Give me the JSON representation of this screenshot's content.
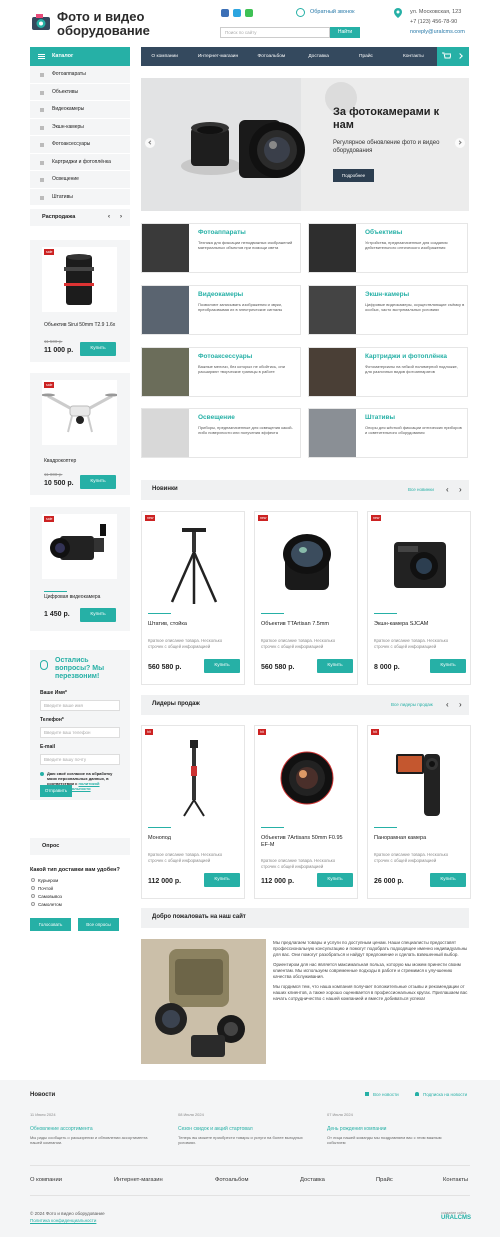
{
  "header": {
    "logo_line1": "Фото и видео",
    "logo_line2": "оборудование",
    "search_placeholder": "Поиск по сайту",
    "search_button": "Найти",
    "callback": "Обратный звонок",
    "address": "ул. Московская, 123",
    "phone": "+7 (123) 456-78-90",
    "email": "noreply@uralcms.com"
  },
  "nav": {
    "catalog": "Каталог",
    "items": [
      "О компании",
      "Интернет-магазин",
      "Фотоальбом",
      "Доставка",
      "Прайс",
      "Контакты"
    ]
  },
  "catalog": [
    "Фотоаппараты",
    "Объективы",
    "Видеокамеры",
    "Экшн-камеры",
    "Фотоаксессуары",
    "Картриджи и фотоплёнка",
    "Освещение",
    "Штативы"
  ],
  "sale": {
    "title": "Распродажа",
    "items": [
      {
        "name": "Объектив Sirui 50mm T2.9 1.6x",
        "old": "11 500 р.",
        "price": "11 000 р.",
        "badge": "sale"
      },
      {
        "name": "Квадрокоптер",
        "old": "11 000 р.",
        "price": "10 500 р.",
        "badge": "sale"
      },
      {
        "name": "Цифровая видеокамера",
        "old": "",
        "price": "1 450 р.",
        "badge": "sale"
      }
    ],
    "buy": "Купить"
  },
  "callback_form": {
    "title": "Остались вопросы? Мы перезвоним!",
    "name_label": "Ваше Имя*",
    "name_ph": "Введите ваше имя",
    "phone_label": "Телефон*",
    "phone_ph": "Введите ваш телефон",
    "email_label": "E-mail",
    "email_ph": "Введите вашу почту",
    "consent": "Даю своё согласие на обработку моих персональных данных, в соответствии с ",
    "consent_link": "политикой конфиденциальности",
    "submit": "Отправить"
  },
  "poll": {
    "title": "Опрос",
    "question": "Какой тип доставки вам удобен?",
    "options": [
      "Курьером",
      "Почтой",
      "Самовывоз",
      "Самолетом"
    ],
    "vote": "Голосовать",
    "all": "Все опросы"
  },
  "hero": {
    "title": "За фотокамерами к нам",
    "subtitle": "Регулярное обновление фото и видео оборудования",
    "button": "Подробнее"
  },
  "categories": [
    {
      "title": "Фотоаппараты",
      "desc": "Техника для фиксации неподвижных изображений материальных объектов при помощи света"
    },
    {
      "title": "Объективы",
      "desc": "Устройства, предназначенные для создания действительного оптического изображения"
    },
    {
      "title": "Видеокамеры",
      "desc": "Позволяют записывать изображения и звуки, преобразовывая их в электрические сигналы"
    },
    {
      "title": "Экшн-камеры",
      "desc": "Цифровые видеокамеры, осуществляющие съёмку в особых, часто экстремальных условиях"
    },
    {
      "title": "Фотоаксессуары",
      "desc": "Важные мелочи, без которых не обойтись, они расширяют творческие границы в работе"
    },
    {
      "title": "Картриджи и фотоплёнка",
      "desc": "Фотоматериалы на гибкой полимерной подложке, для различных видов фотоаппаратов"
    },
    {
      "title": "Освещение",
      "desc": "Приборы, предназначенные для освещения какой-либо поверхности или получения эффекта"
    },
    {
      "title": "Штативы",
      "desc": "Опоры для жёсткой фиксации оптических приборов и осветительного оборудования"
    }
  ],
  "novelties": {
    "title": "Новинки",
    "link": "Все новинки",
    "items": [
      {
        "name": "Штатив, стойка",
        "desc": "Краткое описание товара. Несколько строчек с общей информацией",
        "price": "560 580 р.",
        "badge": "new"
      },
      {
        "name": "Объектив TTArtisan 7.5mm",
        "desc": "Краткое описание товара. Несколько строчек с общей информацией",
        "price": "560 580 р.",
        "badge": "new"
      },
      {
        "name": "Экшн-камера SJCAM",
        "desc": "Краткое описание товара. Несколько строчек с общей информацией",
        "price": "8 000 р.",
        "badge": "new"
      }
    ]
  },
  "leaders": {
    "title": "Лидеры продаж",
    "link": "Все лидеры продаж",
    "items": [
      {
        "name": "Монопод",
        "desc": "Краткое описание товара. Несколько строчек с общей информацией",
        "price": "112 000 р.",
        "badge": "hit"
      },
      {
        "name": "Объектив 7Artisans 50mm F0.95 EF-M",
        "desc": "Краткое описание товара. Несколько строчек с общей информацией",
        "price": "112 000 р.",
        "badge": "hit"
      },
      {
        "name": "Панорамная камера",
        "desc": "Краткое описание товара. Несколько строчек с общей информацией",
        "price": "26 000 р.",
        "badge": "hit"
      }
    ]
  },
  "welcome": {
    "title": "Добро пожаловать на наш сайт",
    "p1": "Мы предлагаем товары и услуги по доступным ценам. Наши специалисты предоставят профессиональную консультацию и помогут подобрать подходящее именно индивидуальны для вас. Они помогут разобраться и найдут предложение и сделать взвешенный выбор.",
    "p2": "Ориентиром для нас является максимальная польза, которую мы можем принести своим клиентам. Мы используем современные подходы в работе и стремимся к улучшению качества обслуживания.",
    "p3": "Мы гордимся тем, что наша компания получает положительные отзывы и рекомендации от наших клиентов, а также хорошо оценивается в профессиональных кругах. Приглашаем вас начать сотрудничество с нашей компанией и вместе добиваться успеха!"
  },
  "news": {
    "title": "Новости",
    "all": "Все новости",
    "subscribe": "Подписка на новости",
    "items": [
      {
        "date": "11 Июля 2024",
        "title": "Обновление ассортимента",
        "text": "Мы рады сообщить о расширении и обновлении ассортимента нашей компании."
      },
      {
        "date": "08 Июля 2024",
        "title": "Сезон скидок и акций стартовал",
        "text": "Теперь вы можете приобрести товары и услуги на более выгодных условиях."
      },
      {
        "date": "07 Июля 2024",
        "title": "День рождения компании",
        "text": "От лица нашей команды мы поздравляем вас с этим важным событием"
      }
    ]
  },
  "footer": {
    "nav": [
      "О компании",
      "Интернет-магазин",
      "Фотоальбом",
      "Доставка",
      "Прайс",
      "Контакты"
    ],
    "copyright": "© 2024 Фото и видео оборудование",
    "policy": "Политика конфиденциальности",
    "dev_label": "создание сайта",
    "dev": "URALCMS"
  },
  "colors": {
    "accent": "#26b0a6",
    "nav": "#34495e",
    "badge": "#cc2222"
  }
}
